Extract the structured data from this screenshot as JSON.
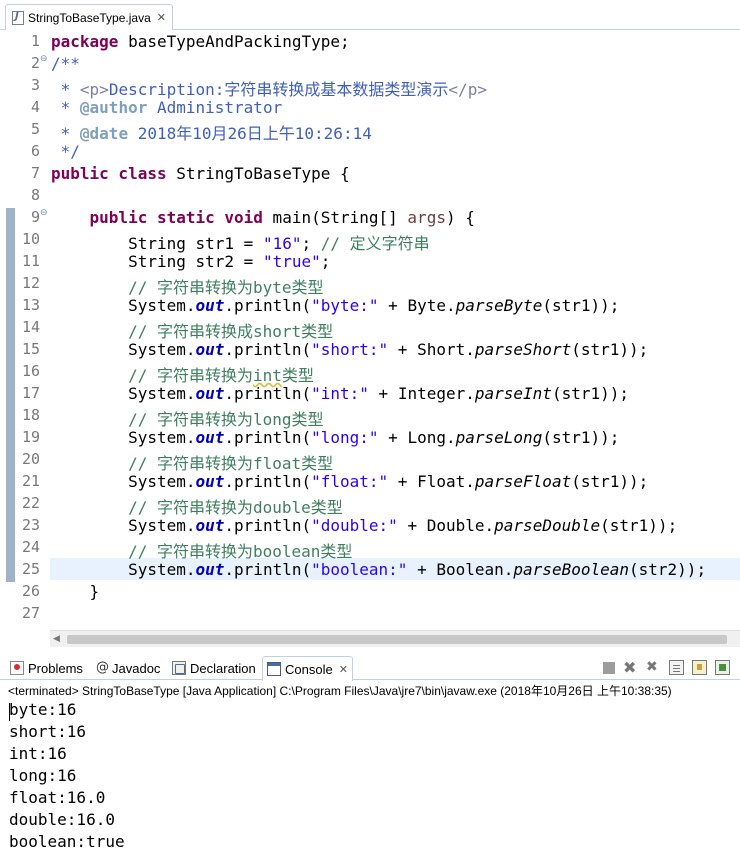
{
  "editor": {
    "tab_label": "StringToBaseType.java",
    "close_glyph": "✕"
  },
  "code": {
    "line_numbers": [
      "1",
      "2",
      "3",
      "4",
      "5",
      "6",
      "7",
      "8",
      "9",
      "10",
      "11",
      "12",
      "13",
      "14",
      "15",
      "16",
      "17",
      "18",
      "19",
      "20",
      "21",
      "22",
      "23",
      "24",
      "25",
      "26",
      "27"
    ],
    "package_kw": "package",
    "package_rest": " baseTypeAndPackingType;",
    "doc_open": "/**",
    "doc_star": " * ",
    "doc_p_open": "<p>",
    "doc_desc": "Description:字符串转换成基本数据类型演示",
    "doc_p_close": "</p>",
    "author_tag": "@author",
    "author_value": " Administrator",
    "date_tag": "@date",
    "date_value": " 2018年10月26日上午10:26:14",
    "doc_close": " */",
    "class_mods": "public class",
    "class_name": " StringToBaseType {",
    "method_indent": "    ",
    "method_mods": "public static void",
    "method_sig_pre": " main(String[] ",
    "method_param": "args",
    "method_sig_post": ") {",
    "str1_pre": "        String ",
    "str1_var": "str1",
    "str1_eq": " = ",
    "str1_val": "\"16\"",
    "str1_semi": "; ",
    "str1_comment": "// 定义字符串",
    "str2_pre": "        String ",
    "str2_var": "str2",
    "str2_eq": " = ",
    "str2_val": "\"true\"",
    "str2_semi": ";",
    "c_byte": "        // 字符串转换为byte类型",
    "c_short": "        // 字符串转换成short类型",
    "c_int_pre": "        // 字符串转换为",
    "c_int_word": "int",
    "c_int_post": "类型",
    "c_long": "        // 字符串转换为long类型",
    "c_float": "        // 字符串转换为float类型",
    "c_double": "        // 字符串转换为double类型",
    "c_boolean": "        // 字符串转换为boolean类型",
    "sys": "        System.",
    "out": "out",
    "println": ".println(",
    "plus": " + ",
    "byte_str": "\"byte:\"",
    "byte_cls": "Byte.",
    "byte_m": "parseByte",
    "short_str": "\"short:\"",
    "short_cls": "Short.",
    "short_m": "parseShort",
    "int_str": "\"int:\"",
    "int_cls": "Integer.",
    "int_m": "parseInt",
    "long_str": "\"long:\"",
    "long_cls": "Long.",
    "long_m": "parseLong",
    "float_str": "\"float:\"",
    "float_cls": "Float.",
    "float_m": "parseFloat",
    "double_str": "\"double:\"",
    "double_cls": "Double.",
    "double_m": "parseDouble",
    "boolean_str": "\"boolean:\"",
    "boolean_cls": "Boolean.",
    "boolean_m": "parseBoolean",
    "arg_open": "(",
    "arg1": "str1",
    "arg2": "str2",
    "arg_close": "));",
    "method_close": "    }",
    "fold_glyph": "⊖"
  },
  "views": {
    "problems": "Problems",
    "javadoc": "Javadoc",
    "javadoc_glyph": "@",
    "declaration": "Declaration",
    "console": "Console",
    "close_glyph": "✕"
  },
  "console": {
    "header": "<terminated> StringToBaseType [Java Application] C:\\Program Files\\Java\\jre7\\bin\\javaw.exe (2018年10月26日 上午10:38:35)",
    "output": [
      "byte:16",
      "short:16",
      "int:16",
      "long:16",
      "float:16.0",
      "double:16.0",
      "boolean:true"
    ]
  },
  "icons": [
    "java-file-icon",
    "problems-icon",
    "javadoc-icon",
    "declaration-icon",
    "console-icon",
    "terminate-icon",
    "remove-launch-icon",
    "remove-all-icon",
    "clear-console-icon",
    "scroll-lock-icon",
    "pin-console-icon"
  ],
  "colors": {
    "keyword": "#7f0055",
    "string": "#2a00ff",
    "comment": "#3f7f5f",
    "javadoc": "#3f5fbf",
    "static_field": "#0000c0",
    "current_line": "#e8f2fe"
  }
}
